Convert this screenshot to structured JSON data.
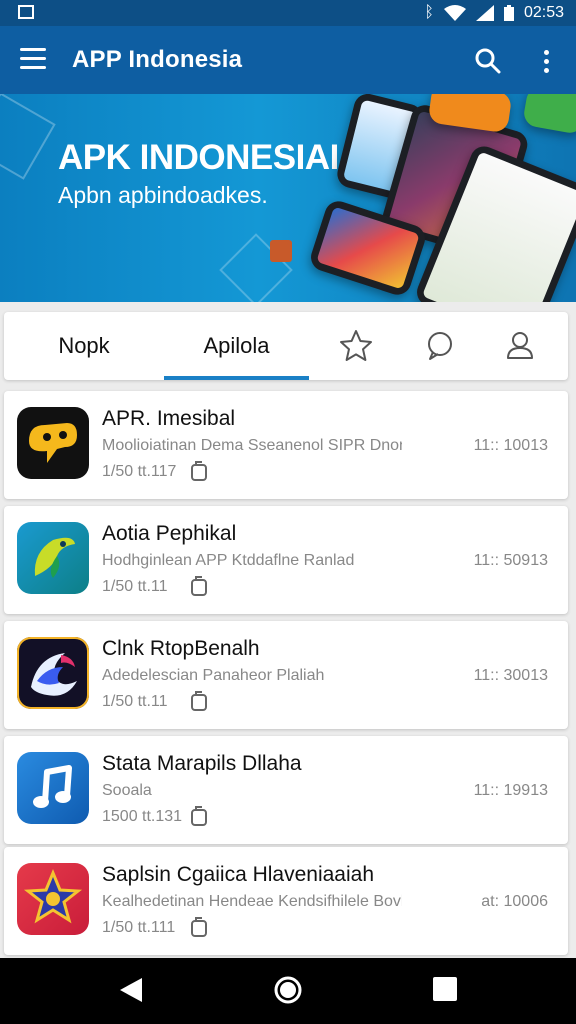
{
  "status_bar": {
    "time": "02:53"
  },
  "toolbar": {
    "title": "APP Indonesia"
  },
  "banner": {
    "headline": "APK INDONESIAI",
    "subline": "Apbn apbindoadkes."
  },
  "tabs": [
    {
      "label": "Nopk"
    },
    {
      "label": "Apilola",
      "selected": true
    }
  ],
  "tab_icons": [
    "star-icon",
    "chat-bubble-icon",
    "person-icon"
  ],
  "apps": [
    {
      "name": "APR. Imesibal",
      "desc": "Moolioiatinan Dema Sseanenol SIPR Dnon",
      "meta": "1/50 tt.117",
      "side": "11:: 10013",
      "icon": "yellow-face-on-black"
    },
    {
      "name": "Aotia Pephikal",
      "desc": "Hodhginlean APP Ktddaflne Ranlad",
      "meta": "1/50 tt.11",
      "side": "11:: 50913",
      "icon": "green-parrot-on-teal"
    },
    {
      "name": "Clnk RtopBenalh",
      "desc": "Adedelescian Panaheor Plaliah",
      "meta": "1/50 tt.11",
      "side": "11:: 30013",
      "icon": "swirl-on-dark"
    },
    {
      "name": "Stata Marapils Dllaha",
      "desc": "Sooala",
      "meta": "1500 tt.131",
      "side": "11:: 19913",
      "icon": "music-note-on-blue"
    },
    {
      "name": "Saplsin Cgaiica Hlaveniaaiah",
      "desc": "Kealhedetinan Hendeae Kendsifhilele Bovld",
      "meta": "1/50 tt.111",
      "side": "at: 10006",
      "icon": "star-on-red"
    }
  ],
  "colors": {
    "toolbar": "#0e5ea2",
    "status": "#0d4f86",
    "accent": "#1a80c6"
  }
}
